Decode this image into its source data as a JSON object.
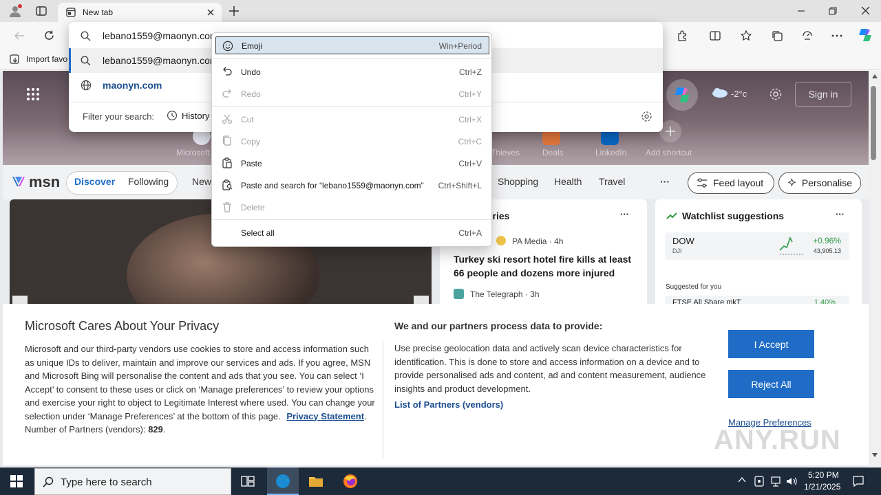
{
  "browser": {
    "tab_title": "New tab",
    "favorites_import_label": "Import favo"
  },
  "omnibox": {
    "input_value": "lebano1559@maonyn.com",
    "suggestions": [
      {
        "text": "lebano1559@maonyn.com",
        "icon": "search-icon"
      },
      {
        "text": "maonyn.com",
        "icon": "globe-icon"
      }
    ],
    "filter_label": "Filter your search:",
    "history_label": "History"
  },
  "context_menu": {
    "items": [
      {
        "label": "Emoji",
        "shortcut": "Win+Period",
        "enabled": true,
        "icon": "emoji-icon"
      },
      {
        "label": "Undo",
        "shortcut": "Ctrl+Z",
        "enabled": true,
        "icon": "undo-icon"
      },
      {
        "label": "Redo",
        "shortcut": "Ctrl+Y",
        "enabled": false,
        "icon": "redo-icon"
      },
      {
        "label": "Cut",
        "shortcut": "Ctrl+X",
        "enabled": false,
        "icon": "cut-icon"
      },
      {
        "label": "Copy",
        "shortcut": "Ctrl+C",
        "enabled": false,
        "icon": "copy-icon"
      },
      {
        "label": "Paste",
        "shortcut": "Ctrl+V",
        "enabled": true,
        "icon": "paste-icon"
      },
      {
        "label": "Paste and search for “lebano1559@maonyn.com”",
        "shortcut": "Ctrl+Shift+L",
        "enabled": true,
        "icon": "paste-search-icon"
      },
      {
        "label": "Delete",
        "shortcut": "",
        "enabled": false,
        "icon": "delete-icon"
      },
      {
        "label": "Select all",
        "shortcut": "Ctrl+A",
        "enabled": true,
        "icon": ""
      }
    ]
  },
  "newtab": {
    "weather": "-2°c",
    "sign_in": "Sign in",
    "shortcuts": [
      {
        "label": "Microsoft"
      },
      {
        "label": "Thieves"
      },
      {
        "label": "Deals"
      },
      {
        "label": "LinkedIn"
      },
      {
        "label": "Add shortcut"
      }
    ]
  },
  "msn": {
    "logo": "msn",
    "nav": {
      "discover": "Discover",
      "following": "Following",
      "news": "New",
      "shopping": "Shopping",
      "health": "Health",
      "travel": "Travel",
      "more": "···"
    },
    "feed_layout": "Feed layout",
    "personalise": "Personalise",
    "stories": {
      "heading": "ories",
      "items": [
        {
          "source": "PA Media · 4h",
          "headline": "Turkey ski resort hotel fire kills at least 66 people and dozens more injured"
        },
        {
          "source": "The Telegraph · 3h",
          "headline": ""
        }
      ]
    },
    "watchlist": {
      "title": "Watchlist suggestions",
      "ticker": "DOW",
      "ticker_sub": "DJI",
      "change": "+0.96%",
      "price": "43,905.13",
      "suggested_label": "Suggested for you",
      "second_ticker": "FTSE All Share mkT",
      "second_change": "1.40%"
    }
  },
  "privacy": {
    "title": "Microsoft Cares About Your Privacy",
    "body": "Microsoft and our third-party vendors use cookies to store and access information such as unique IDs to deliver, maintain and improve our services and ads. If you agree, MSN and Microsoft Bing will personalise the content and ads that you see. You can select ‘I Accept’ to consent to these uses or click on ‘Manage preferences’ to review your options and exercise your right to object to Legitimate Interest where used.  You can change your selection under ‘Manage Preferences’ at the bottom of this page.",
    "privacy_link": "Privacy Statement",
    "partners_prefix": "Number of Partners (vendors):",
    "partners_count": "829",
    "right_title": "We and our partners process data to provide:",
    "right_body": "Use precise geolocation data and actively scan device characteristics for identification. This is done to store and access information on a device and to provide personalised ads and content, ad and content measurement, audience insights and product development.",
    "partners_link": "List of Partners (vendors)",
    "accept": "I Accept",
    "reject": "Reject All",
    "manage": "Manage Preferences"
  },
  "taskbar": {
    "search_placeholder": "Type here to search",
    "time": "5:20 PM",
    "date": "1/21/2025"
  },
  "watermark": "ANY.RUN"
}
